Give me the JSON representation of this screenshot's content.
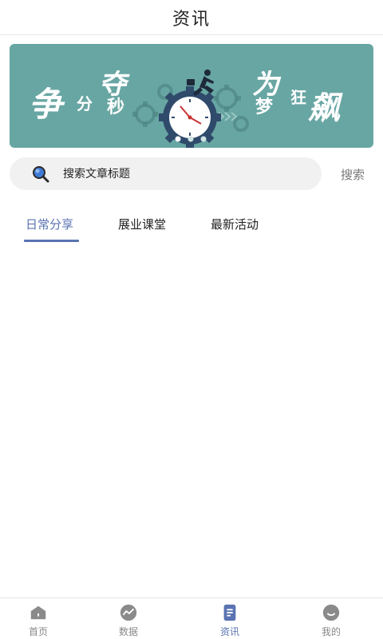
{
  "header": {
    "title": "资讯"
  },
  "banner": {
    "slogan_left_big": "争",
    "slogan_left_small_1": "分",
    "slogan_left_big_2": "夺",
    "slogan_left_small_2": "秒",
    "slogan_right_big_1": "为",
    "slogan_right_small_1": "梦",
    "slogan_right_small_2": "狂",
    "slogan_right_big_2": "飙",
    "slide_count": 3,
    "active_slide": 1,
    "colors": {
      "background": "#68a6a3",
      "gear": "#5b8f8c",
      "clock_face": "#ffffff",
      "clock_ring": "#2f4a6b"
    }
  },
  "search": {
    "placeholder": "搜索文章标题",
    "button_label": "搜索"
  },
  "tabs": [
    {
      "label": "日常分享",
      "active": true
    },
    {
      "label": "展业课堂",
      "active": false
    },
    {
      "label": "最新活动",
      "active": false
    }
  ],
  "bottom_nav": [
    {
      "label": "首页",
      "icon": "home-icon",
      "active": false
    },
    {
      "label": "数据",
      "icon": "data-icon",
      "active": false
    },
    {
      "label": "资讯",
      "icon": "news-icon",
      "active": true
    },
    {
      "label": "我的",
      "icon": "profile-icon",
      "active": false
    }
  ],
  "colors": {
    "accent": "#5a73b2",
    "inactive": "#888888",
    "search_bg": "#f1f1f1"
  }
}
